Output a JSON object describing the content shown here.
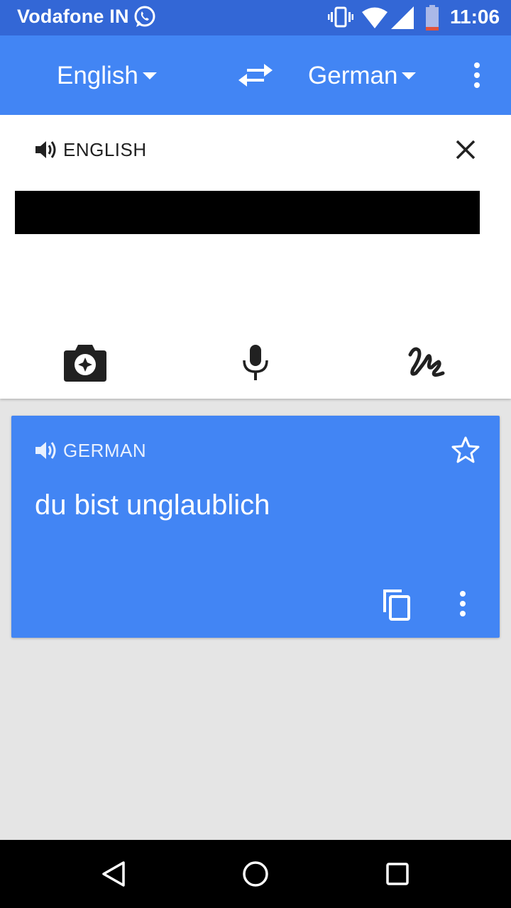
{
  "status_bar": {
    "carrier": "Vodafone IN",
    "time": "11:06",
    "icons": [
      "whatsapp-icon",
      "vibrate-icon",
      "wifi-icon",
      "cell-signal-icon",
      "battery-icon"
    ]
  },
  "app_bar": {
    "source_language": "English",
    "target_language": "German",
    "icons": [
      "swap-languages-icon",
      "overflow-menu-icon",
      "dropdown-caret-icon"
    ]
  },
  "input_panel": {
    "language_label": "ENGLISH",
    "text": "",
    "text_redacted": true,
    "icons": [
      "speaker-icon",
      "close-icon"
    ],
    "tools": [
      "camera-icon",
      "microphone-icon",
      "handwriting-icon"
    ]
  },
  "result_card": {
    "language_label": "GERMAN",
    "translation": "du bist unglaublich",
    "icons": [
      "speaker-icon",
      "star-icon",
      "copy-icon",
      "overflow-menu-icon"
    ]
  },
  "nav_bar": {
    "icons": [
      "back-icon",
      "home-icon",
      "recents-icon"
    ]
  },
  "colors": {
    "status_bar": "#3367d6",
    "app_bar": "#4285f4",
    "result_card": "#4285f4",
    "background": "#e5e5e5",
    "nav_bar": "#000000"
  }
}
